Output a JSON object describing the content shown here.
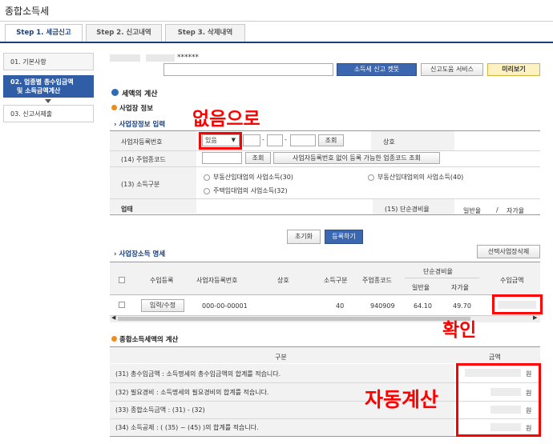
{
  "app": {
    "title": "종합소득세"
  },
  "tabs": [
    {
      "label": "Step 1. 세금신고"
    },
    {
      "label": "Step 2. 신고내역"
    },
    {
      "label": "Step 3. 삭제내역"
    }
  ],
  "sidebar": {
    "items": [
      {
        "label": "01. 기본사항"
      },
      {
        "label": "02. 업종별 총수입금액",
        "label2": "및 소득금액계산"
      },
      {
        "label": "03. 신고서제출"
      }
    ]
  },
  "toolbar": {
    "masked_id": "******",
    "quick_label": "소득세 신고 켓뜻",
    "help_label": "신고도움 서비스",
    "preview_label": "미리보기"
  },
  "calc": {
    "title": "세액의 계산",
    "biz_info_title": "사업장 정보",
    "biz_input_title": "사업장정보 입력",
    "reg_label": "사업자등록번호",
    "reg_select_value": "있음",
    "lookup_label": "조회",
    "trade_name_label": "상호",
    "industry_label": "(14) 주업종코드",
    "industry_lookup_label": "조회",
    "industry_noreg_label": "사업자등록번호 없이 등록 가능한 업종코드 조회",
    "income_type_label": "(13) 소득구분",
    "radio1": "부동산임대업의 사업소득(30)",
    "radio2": "부동산임대업외의 사업소득(40)",
    "radio3": "주택임대업의 사업소득(32)",
    "business_label": "업태",
    "simple_rate_label": "(15) 단순경비율",
    "general_rate": "일반율",
    "self_rate": "자가율",
    "slash": "/",
    "reset_label": "초기화",
    "register_label": "등록하기"
  },
  "income_table": {
    "title": "사업장소득 명세",
    "delete_label": "선택사업장삭제",
    "headers": {
      "register": "수입등록",
      "reg_no": "사업자등록번호",
      "name": "상호",
      "type": "소득구분",
      "code": "주업종코드",
      "simple": "단순경비율",
      "general": "일반율",
      "self": "자가율",
      "revenue": "수입금액"
    },
    "rows": [
      {
        "button": "입력/수정",
        "reg_no": "000-00-00001",
        "name": "",
        "type": "40",
        "code": "940909",
        "general": "64.10",
        "self": "49.70",
        "revenue": ""
      }
    ]
  },
  "total_calc": {
    "title": "종합소득세액의 계산",
    "col_item": "구분",
    "col_amount": "금액",
    "rows": [
      {
        "label": "(31) 총수입금액 : 소득명세의 총수입금액의 합계를 적습니다.",
        "unit": "원"
      },
      {
        "label": "(32) 필요경비 : 소득명세의 필요경비의 합계를 적습니다.",
        "unit": "원"
      },
      {
        "label": "(33) 종합소득금액 : (31) - (32)",
        "unit": "원"
      },
      {
        "label": "(34) 소득공제 : ( (35) ~ (45) )의 합계를 적습니다.",
        "unit": "원"
      }
    ]
  },
  "annotations": {
    "none": "없음으로",
    "confirm": "확인",
    "auto": "자동계산",
    "color": "#ff0000"
  }
}
